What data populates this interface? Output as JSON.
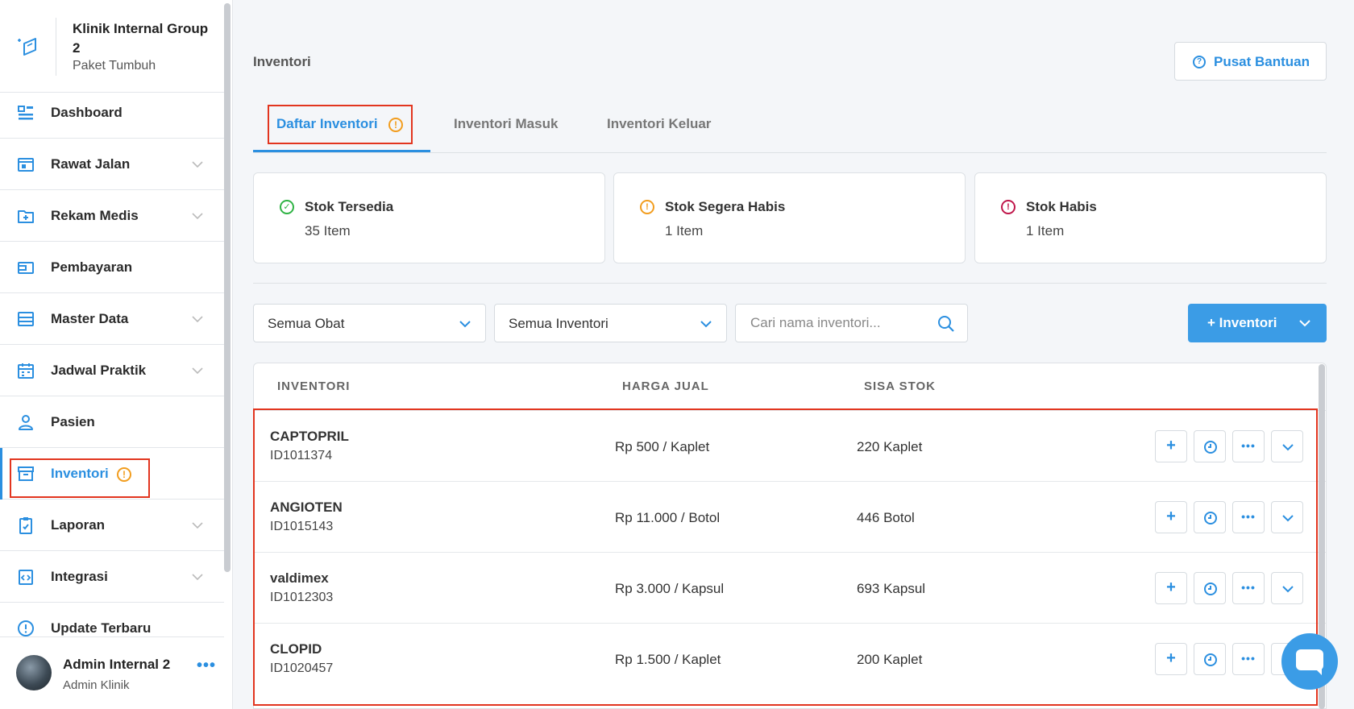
{
  "sidebar": {
    "org_name": "Klinik Internal Group 2",
    "org_plan": "Paket Tumbuh",
    "items": [
      {
        "label": "Dashboard",
        "icon": "dashboard-icon"
      },
      {
        "label": "Rawat Jalan",
        "icon": "outpatient-icon"
      },
      {
        "label": "Rekam Medis",
        "icon": "medical-record-icon"
      },
      {
        "label": "Pembayaran",
        "icon": "payment-icon"
      },
      {
        "label": "Master Data",
        "icon": "master-data-icon"
      },
      {
        "label": "Jadwal Praktik",
        "icon": "calendar-icon"
      },
      {
        "label": "Pasien",
        "icon": "patient-icon"
      },
      {
        "label": "Inventori",
        "icon": "inventory-icon",
        "badge": "!"
      },
      {
        "label": "Laporan",
        "icon": "report-icon"
      },
      {
        "label": "Integrasi",
        "icon": "integration-icon"
      },
      {
        "label": "Update Terbaru",
        "icon": "info-icon"
      }
    ],
    "user_name": "Admin Internal 2",
    "user_role": "Admin Klinik",
    "more": "•••"
  },
  "main": {
    "page_title": "Inventori",
    "help_label": "Pusat Bantuan",
    "tabs": [
      {
        "label": "Daftar Inventori",
        "badge": "!"
      },
      {
        "label": "Inventori Masuk"
      },
      {
        "label": "Inventori Keluar"
      }
    ],
    "cards": [
      {
        "title": "Stok Tersedia",
        "value": "35 Item",
        "icon": "✓",
        "color": "#2fb344"
      },
      {
        "title": "Stok Segera Habis",
        "value": "1 Item",
        "icon": "!",
        "color": "#f29d1e"
      },
      {
        "title": "Stok Habis",
        "value": "1 Item",
        "icon": "!",
        "color": "#c0174b"
      }
    ],
    "filters": {
      "category": "Semua Obat",
      "inventory": "Semua Inventori",
      "search_placeholder": "Cari nama inventori..."
    },
    "add_button": "+ Inventori",
    "table": {
      "headers": [
        "INVENTORI",
        "HARGA JUAL",
        "SISA STOK"
      ],
      "rows": [
        {
          "name": "CAPTOPRIL",
          "id": "ID1011374",
          "price": "Rp 500 / Kaplet",
          "stock": "220 Kaplet"
        },
        {
          "name": "ANGIOTEN",
          "id": "ID1015143",
          "price": "Rp 11.000 / Botol",
          "stock": "446 Botol"
        },
        {
          "name": "valdimex",
          "id": "ID1012303",
          "price": "Rp 3.000 / Kapsul",
          "stock": "693 Kapsul"
        },
        {
          "name": "CLOPID",
          "id": "ID1020457",
          "price": "Rp 1.500 / Kaplet",
          "stock": "200 Kaplet"
        }
      ],
      "action_add": "+",
      "action_more": "•••"
    }
  },
  "colors": {
    "accent": "#2b8fe0",
    "button": "#3b9ce6",
    "highlight": "#e2351f",
    "warning": "#f29d1e"
  }
}
